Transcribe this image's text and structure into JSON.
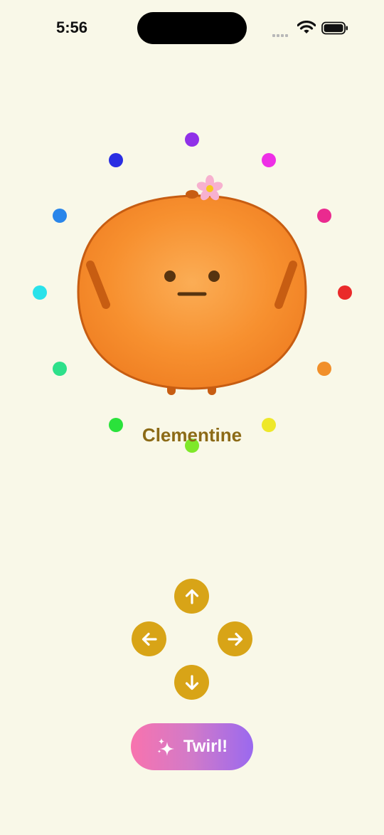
{
  "status_bar": {
    "time": "5:56"
  },
  "character": {
    "name": "Clementine",
    "body_color": "#f7902f",
    "outline_color": "#c75d12"
  },
  "color_dots": [
    {
      "name": "purple",
      "color": "#9031e8"
    },
    {
      "name": "magenta",
      "color": "#ee2fe6"
    },
    {
      "name": "pink",
      "color": "#ea2a8f"
    },
    {
      "name": "red",
      "color": "#ea2a2a"
    },
    {
      "name": "orange",
      "color": "#f18f2a"
    },
    {
      "name": "yellow",
      "color": "#eee82a"
    },
    {
      "name": "lime",
      "color": "#7fe82a"
    },
    {
      "name": "green",
      "color": "#2ae23b"
    },
    {
      "name": "mint",
      "color": "#2ee08a"
    },
    {
      "name": "cyan",
      "color": "#2ae2ea"
    },
    {
      "name": "blue",
      "color": "#2a86ea"
    },
    {
      "name": "indigo",
      "color": "#2a2ee2"
    }
  ],
  "controls": {
    "up_icon": "arrow-up-icon",
    "down_icon": "arrow-down-icon",
    "left_icon": "arrow-left-icon",
    "right_icon": "arrow-right-icon",
    "button_color": "#d8a417"
  },
  "twirl_button": {
    "label": "Twirl!",
    "icon": "sparkles-icon"
  }
}
